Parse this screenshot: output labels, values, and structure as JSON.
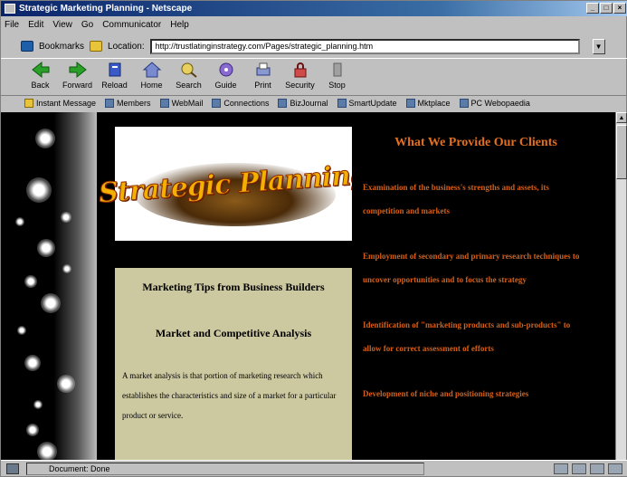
{
  "window": {
    "title": "Strategic Marketing Planning - Netscape",
    "controls": [
      "_",
      "□",
      "×"
    ]
  },
  "menu": [
    "File",
    "Edit",
    "View",
    "Go",
    "Communicator",
    "Help"
  ],
  "location": {
    "bookmarks_label": "Bookmarks",
    "location_label": "Location:",
    "url": "http://trustlatinginstrategy.com/Pages/strategic_planning.htm"
  },
  "nav": {
    "buttons": [
      "Back",
      "Forward",
      "Reload",
      "Home",
      "Search",
      "Guide",
      "Print",
      "Security",
      "Stop"
    ]
  },
  "personal_bar": {
    "items": [
      "Instant Message",
      "Members",
      "WebMail",
      "Connections",
      "BizJournal",
      "SmartUpdate",
      "Mktplace",
      "PC Webopaedia"
    ]
  },
  "page": {
    "logo_text": "Strategic Planning",
    "left": {
      "heading": "Marketing Tips from Business Builders",
      "subheading": "Market and Competitive Analysis",
      "body": "A market analysis is that portion of marketing research which establishes the characteristics and size of a market for a particular product or service."
    },
    "right": {
      "title": "What We Provide Our Clients",
      "items": [
        "Examination of the business's strengths and assets, its competition and markets",
        "Employment of secondary and primary research techniques to uncover opportunities and to focus the strategy",
        "Identification of \"marketing products and sub-products\" to allow for correct assessment of efforts",
        "Development of niche and positioning strategies"
      ]
    }
  },
  "status": {
    "text": "Document: Done"
  }
}
